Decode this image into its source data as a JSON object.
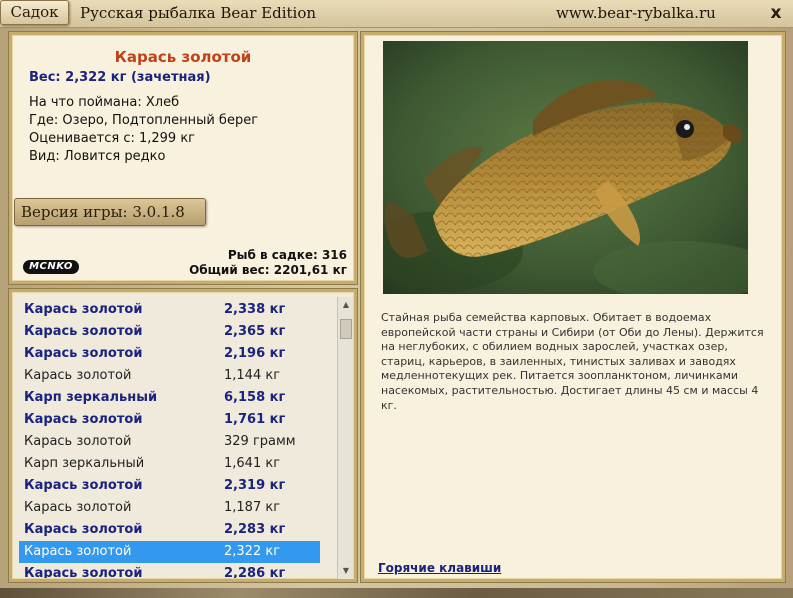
{
  "titlebar": {
    "sadok_label": "Садок",
    "app_title": "Русская рыбалка Bear Edition",
    "site_url": "www.bear-rybalka.ru",
    "close_label": "x"
  },
  "info": {
    "fish_name": "Карась золотой",
    "weight_line": "Вес: 2,322 кг (зачетная)",
    "caught_on": "На что поймана: Хлеб",
    "where": "Где: Озеро, Подтопленный берег",
    "rated_from": "Оценивается с: 1,299 кг",
    "kind": "Вид: Ловится редко",
    "version": "Версия игры: 3.0.1.8",
    "logo_text": "MCNKO",
    "fish_in_keepnet": "Рыб в садке: 316",
    "total_weight": "Общий вес: 2201,61 кг"
  },
  "catch_list": [
    {
      "name": "Карась золотой",
      "weight": "2,338 кг",
      "style": "b"
    },
    {
      "name": "Карась золотой",
      "weight": "2,365 кг",
      "style": "b"
    },
    {
      "name": "Карась золотой",
      "weight": "2,196 кг",
      "style": "b"
    },
    {
      "name": "Карась золотой",
      "weight": "1,144 кг",
      "style": "n"
    },
    {
      "name": "Карп зеркальный",
      "weight": "6,158 кг",
      "style": "b"
    },
    {
      "name": "Карась золотой",
      "weight": "1,761 кг",
      "style": "b"
    },
    {
      "name": "Карась золотой",
      "weight": "329 грамм",
      "style": "n"
    },
    {
      "name": "Карп зеркальный",
      "weight": "1,641 кг",
      "style": "n"
    },
    {
      "name": "Карась золотой",
      "weight": "2,319 кг",
      "style": "b"
    },
    {
      "name": "Карась золотой",
      "weight": "1,187 кг",
      "style": "n"
    },
    {
      "name": "Карась золотой",
      "weight": "2,283 кг",
      "style": "b"
    },
    {
      "name": "Карась золотой",
      "weight": "2,322 кг",
      "style": "sel"
    },
    {
      "name": "Карась золотой",
      "weight": "2,286 кг",
      "style": "b"
    }
  ],
  "description": "Стайная рыба семейства карповых. Обитает в водоемах европейской части страны и Сибири (от Оби до Лены). Держится на неглубоких, с обилием водных зарослей, участках озер, стариц, карьеров, в заиленных, тинистых заливах и заводях медленнотекущих рек.  Питается зоопланктоном, личинками насекомых, растительностью. Достигает длины 45 см и массы 4 кг.",
  "hotkeys_label": "Горячие клавиши"
}
